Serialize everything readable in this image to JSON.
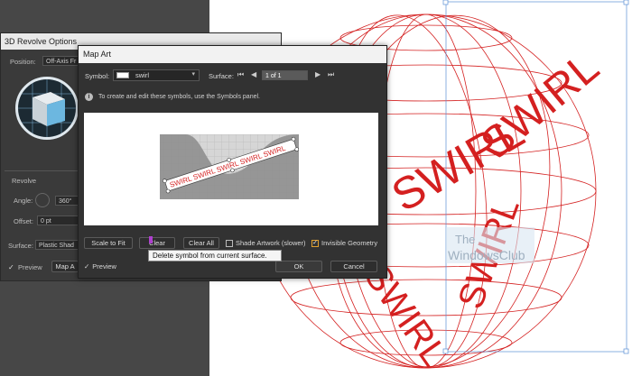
{
  "revolve_dialog": {
    "title": "3D Revolve Options",
    "position_label": "Position:",
    "position_value": "Off-Axis Fr",
    "revolve_section": "Revolve",
    "angle_label": "Angle:",
    "angle_value": "360°",
    "offset_label": "Offset:",
    "offset_value": "0 pt",
    "surface_label": "Surface:",
    "surface_value": "Plastic Shad",
    "preview_label": "Preview",
    "map_art_button": "Map A"
  },
  "map_art_dialog": {
    "title": "Map Art",
    "symbol_label": "Symbol:",
    "symbol_value": "swirl",
    "surface_label": "Surface:",
    "surface_value": "1 of 1",
    "info_text": "To create and edit these symbols, use the Symbols panel.",
    "symbol_text": "SWIRL SWIRL SWIRL SWIRL SWIRL",
    "buttons": {
      "scale_to_fit": "Scale to Fit",
      "clear": "Clear",
      "clear_all": "Clear All",
      "ok": "OK",
      "cancel": "Cancel"
    },
    "shade_artwork_label": "Shade Artwork (slower)",
    "invisible_geometry_label": "Invisible Geometry",
    "invisible_geometry_checked": true,
    "preview_label": "Preview",
    "preview_checked": true,
    "tooltip": "Delete symbol from current surface."
  },
  "artboard": {
    "swirl_text": "SWIRL",
    "watermark_line1": "The",
    "watermark_line2": "WindowsClub",
    "accent_color": "#d42020"
  }
}
